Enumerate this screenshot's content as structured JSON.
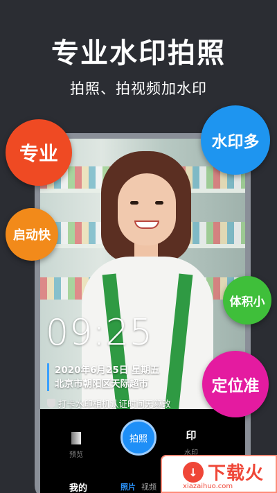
{
  "headline": "专业水印拍照",
  "subhead": "拍照、拍视频加水印",
  "features": {
    "pro": "专业",
    "many_watermarks": "水印多",
    "fast_start": "启动快",
    "small_size": "体积小",
    "accurate_location": "定位准"
  },
  "watermark": {
    "time": "09:25",
    "date_line": "2020年6月25日 星期五",
    "location_line": "北京市朝阳区天际超市",
    "verify_text": "打卡水印相机认证时间无篡改"
  },
  "camera": {
    "preview_label": "预览",
    "shutter_label": "拍照",
    "watermark_glyph": "印",
    "watermark_label": "水印",
    "tab_mine": "我的",
    "tab_photo": "照片",
    "tab_video": "视频"
  },
  "brand": {
    "icon": "↓",
    "name": "下载火",
    "url": "xiazaihuo.com"
  },
  "colors": {
    "background": "#2b2d33",
    "pro": "#ef4a23",
    "many_watermarks": "#1e95f0",
    "fast_start": "#f28a1a",
    "small_size": "#3fbf3a",
    "accurate_location": "#e41ba0",
    "shutter": "#1e8ff7"
  }
}
